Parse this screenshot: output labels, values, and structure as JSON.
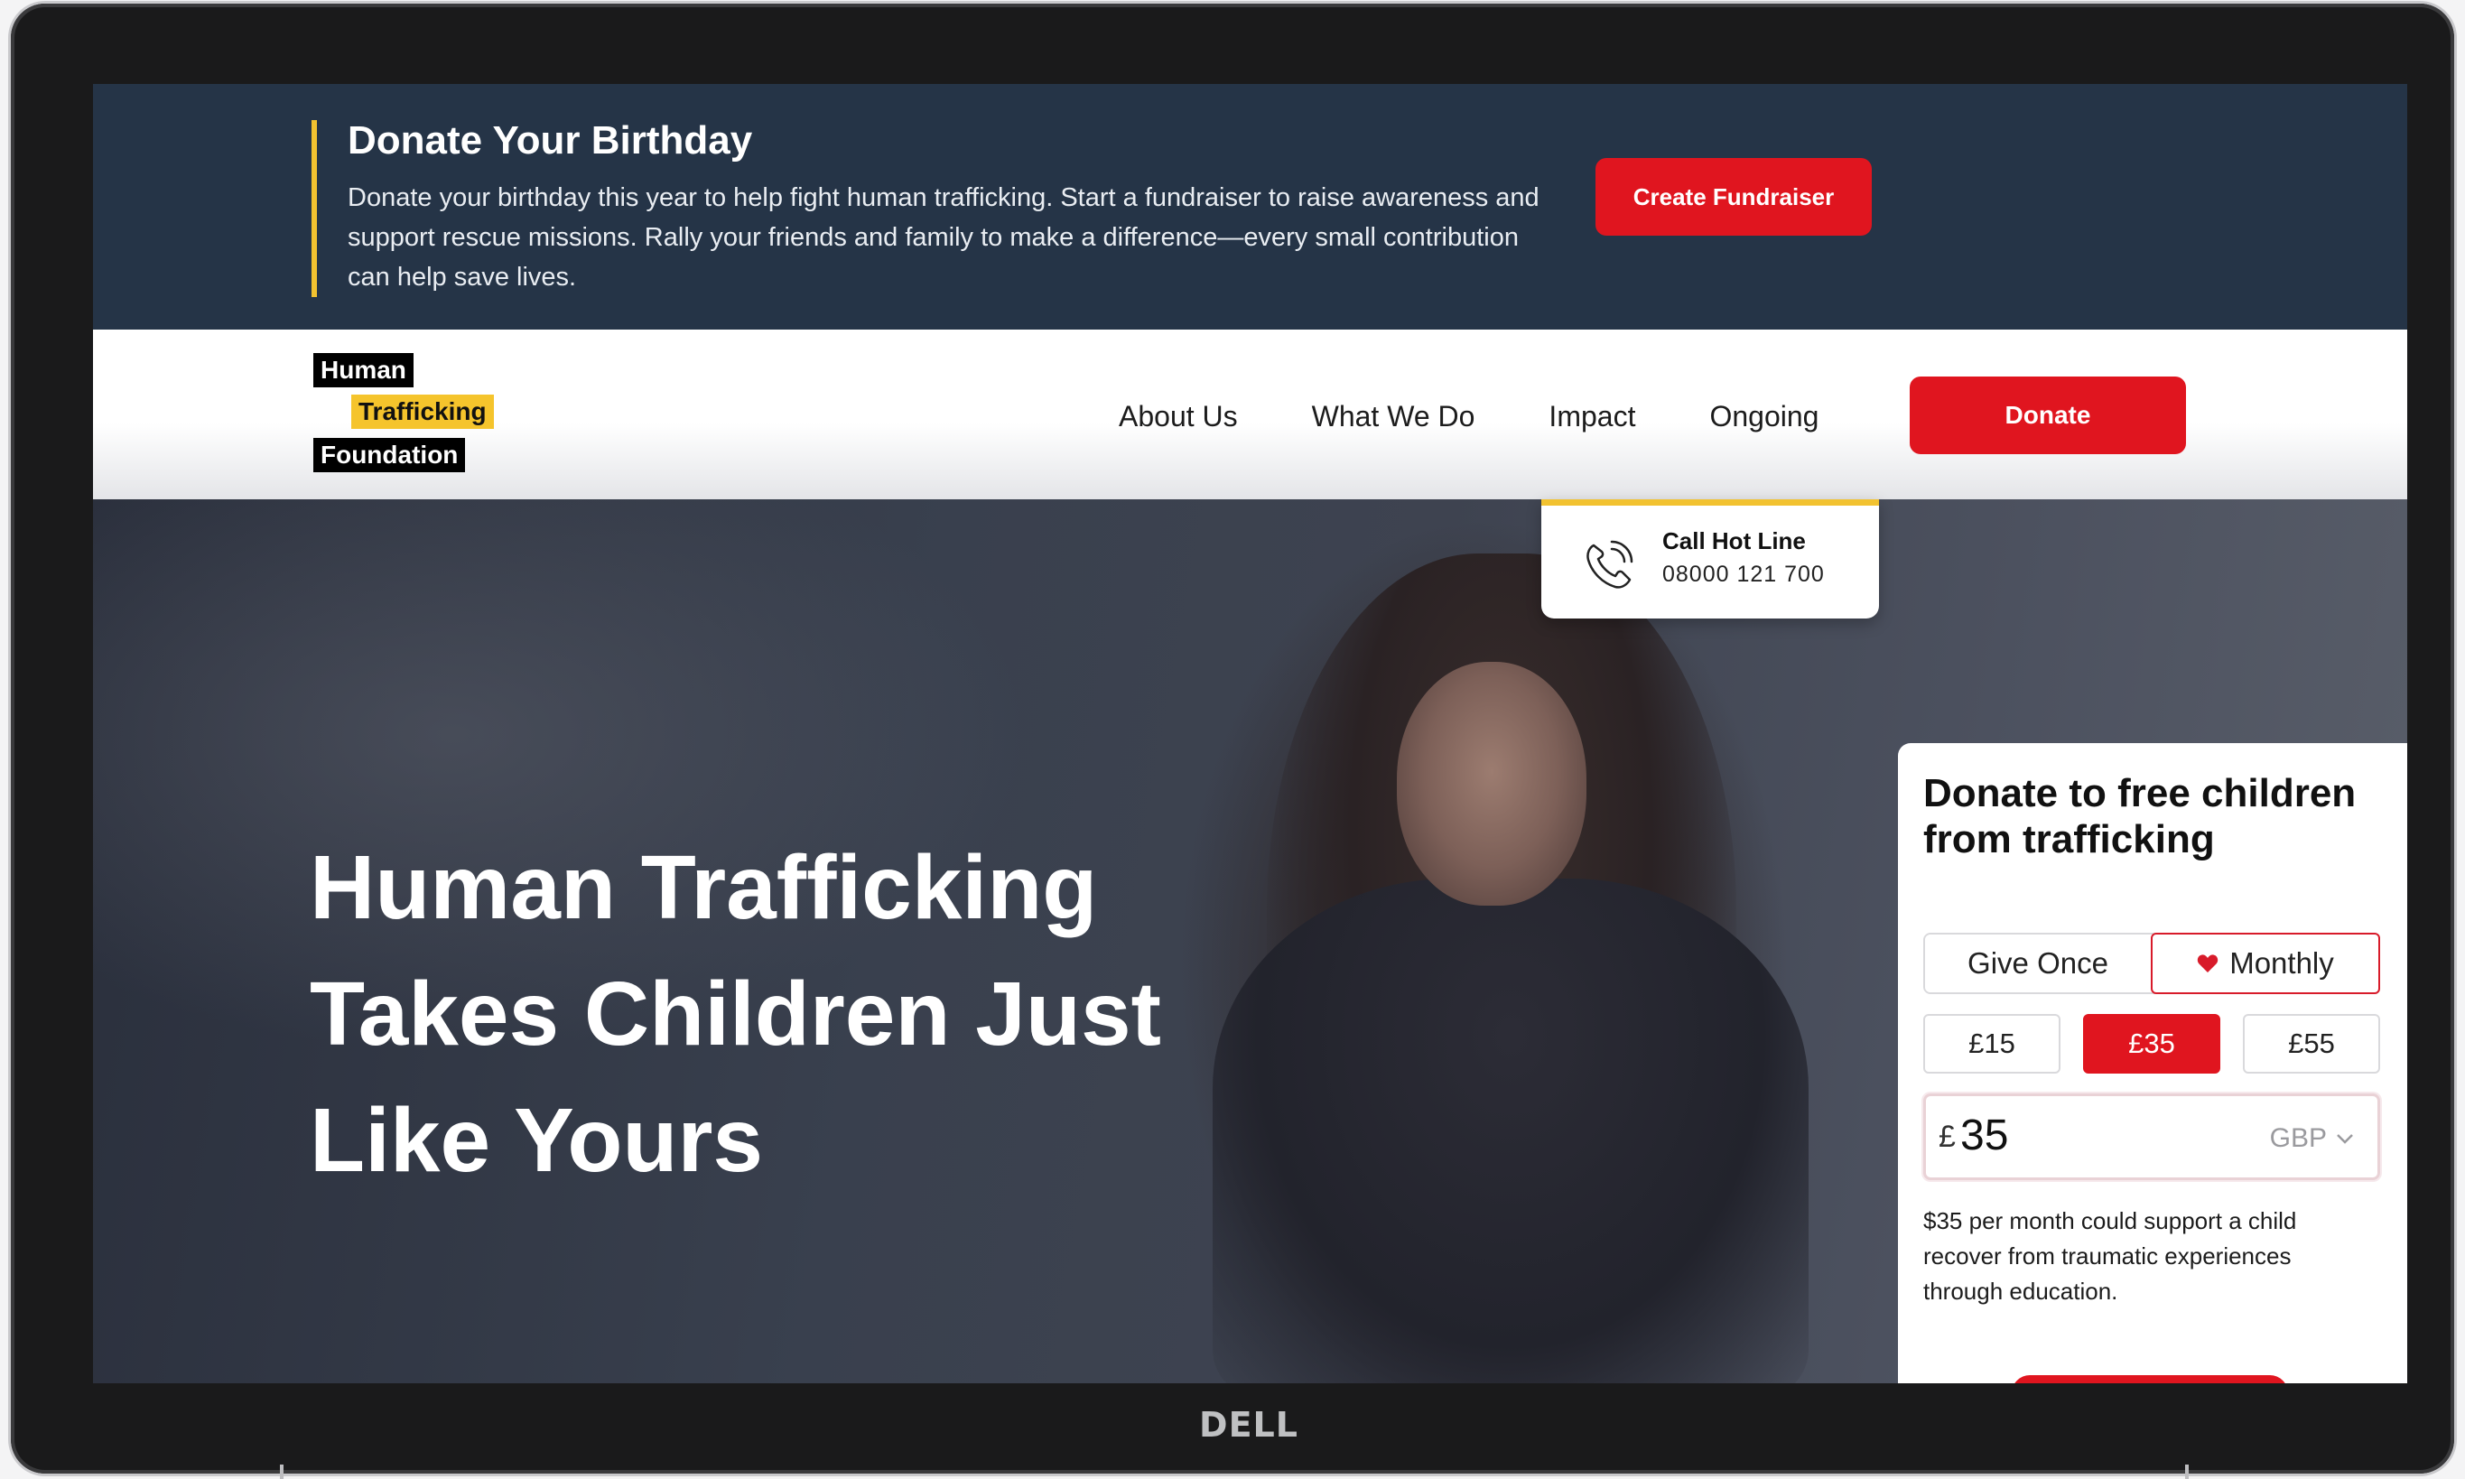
{
  "device": {
    "brand": "DELL"
  },
  "banner": {
    "title": "Donate Your Birthday",
    "text": "Donate your birthday this year to help fight human trafficking. Start a fundraiser to raise awareness and support rescue missions. Rally your friends and family to make a difference—every small contribution can help save lives.",
    "cta_label": "Create Fundraiser"
  },
  "logo": {
    "line1": "Human",
    "line2": "Trafficking",
    "line3": "Foundation"
  },
  "nav": {
    "links": [
      "About Us",
      "What We Do",
      "Impact",
      "Ongoing"
    ],
    "donate_label": "Donate"
  },
  "hotline": {
    "label": "Call Hot Line",
    "number": "08000 121 700",
    "icon": "phone-icon"
  },
  "hero": {
    "line1": "Human Trafficking",
    "line2": "Takes Children Just",
    "line3": "Like Yours"
  },
  "donate_card": {
    "title": "Donate to free children from trafficking",
    "frequency": {
      "once": "Give Once",
      "monthly": "Monthly",
      "selected": "Monthly"
    },
    "amounts": [
      "£15",
      "£35",
      "£55"
    ],
    "selected_amount": "£35",
    "input": {
      "currency_symbol": "£",
      "value": "35",
      "currency": "GBP"
    },
    "impact_text": "$35 per month could support a child recover from traumatic experiences through education."
  },
  "colors": {
    "brand_red": "#e0151f",
    "accent_yellow": "#f2c230",
    "banner_navy": "#253447"
  }
}
